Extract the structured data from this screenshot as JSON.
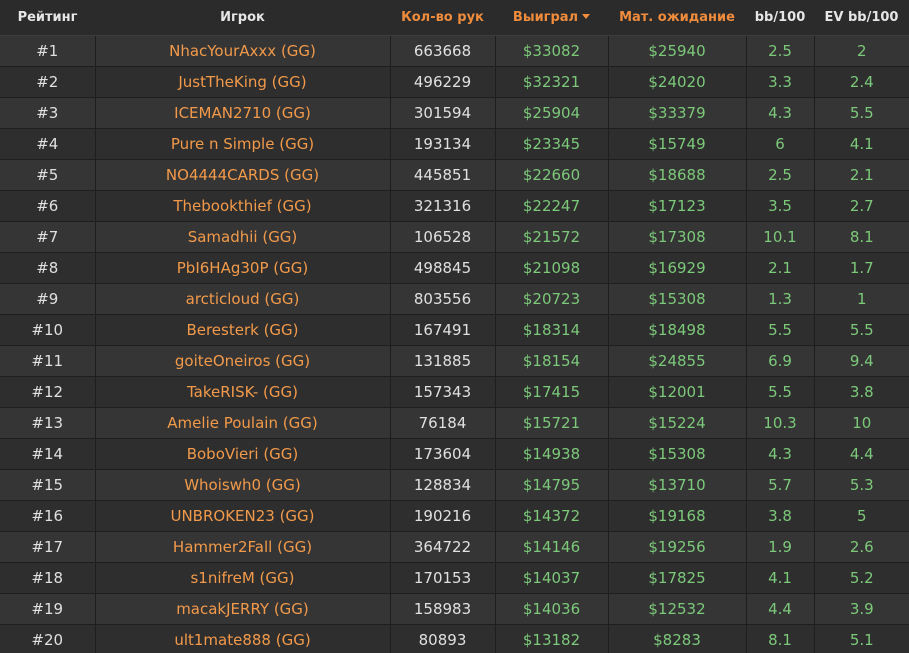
{
  "columns": {
    "rank": "Рейтинг",
    "player": "Игрок",
    "hands": "Кол-во рук",
    "won": "Выиграл",
    "ev": "Мат. ожидание",
    "bb100": "bb/100",
    "evbb100": "EV bb/100"
  },
  "sort": {
    "column": "won",
    "direction": "desc",
    "icon": "caret-down-icon"
  },
  "colors": {
    "background": "#2b2b2b",
    "row_odd": "#353535",
    "row_even": "#2e2e2e",
    "player_link": "#f29a4a",
    "header_accent": "#f08c3c",
    "money_green": "#7cc97a",
    "text_light": "#e0e0e0"
  },
  "rows": [
    {
      "rank": "#1",
      "player": "NhacYourAxxx (GG)",
      "hands": "663668",
      "won": "$33082",
      "ev": "$25940",
      "bb100": "2.5",
      "evbb100": "2"
    },
    {
      "rank": "#2",
      "player": "JustTheKing (GG)",
      "hands": "496229",
      "won": "$32321",
      "ev": "$24020",
      "bb100": "3.3",
      "evbb100": "2.4"
    },
    {
      "rank": "#3",
      "player": "ICEMAN2710 (GG)",
      "hands": "301594",
      "won": "$25904",
      "ev": "$33379",
      "bb100": "4.3",
      "evbb100": "5.5"
    },
    {
      "rank": "#4",
      "player": "Pure n Simple (GG)",
      "hands": "193134",
      "won": "$23345",
      "ev": "$15749",
      "bb100": "6",
      "evbb100": "4.1"
    },
    {
      "rank": "#5",
      "player": "NO4444CARDS (GG)",
      "hands": "445851",
      "won": "$22660",
      "ev": "$18688",
      "bb100": "2.5",
      "evbb100": "2.1"
    },
    {
      "rank": "#6",
      "player": "Thebookthief (GG)",
      "hands": "321316",
      "won": "$22247",
      "ev": "$17123",
      "bb100": "3.5",
      "evbb100": "2.7"
    },
    {
      "rank": "#7",
      "player": "Samadhii (GG)",
      "hands": "106528",
      "won": "$21572",
      "ev": "$17308",
      "bb100": "10.1",
      "evbb100": "8.1"
    },
    {
      "rank": "#8",
      "player": "PbI6HAg30P (GG)",
      "hands": "498845",
      "won": "$21098",
      "ev": "$16929",
      "bb100": "2.1",
      "evbb100": "1.7"
    },
    {
      "rank": "#9",
      "player": "arcticloud (GG)",
      "hands": "803556",
      "won": "$20723",
      "ev": "$15308",
      "bb100": "1.3",
      "evbb100": "1"
    },
    {
      "rank": "#10",
      "player": "Beresterk (GG)",
      "hands": "167491",
      "won": "$18314",
      "ev": "$18498",
      "bb100": "5.5",
      "evbb100": "5.5"
    },
    {
      "rank": "#11",
      "player": "goiteOneiros (GG)",
      "hands": "131885",
      "won": "$18154",
      "ev": "$24855",
      "bb100": "6.9",
      "evbb100": "9.4"
    },
    {
      "rank": "#12",
      "player": "TakeRISK- (GG)",
      "hands": "157343",
      "won": "$17415",
      "ev": "$12001",
      "bb100": "5.5",
      "evbb100": "3.8"
    },
    {
      "rank": "#13",
      "player": "Amelie Poulain (GG)",
      "hands": "76184",
      "won": "$15721",
      "ev": "$15224",
      "bb100": "10.3",
      "evbb100": "10"
    },
    {
      "rank": "#14",
      "player": "BoboVieri (GG)",
      "hands": "173604",
      "won": "$14938",
      "ev": "$15308",
      "bb100": "4.3",
      "evbb100": "4.4"
    },
    {
      "rank": "#15",
      "player": "Whoiswh0 (GG)",
      "hands": "128834",
      "won": "$14795",
      "ev": "$13710",
      "bb100": "5.7",
      "evbb100": "5.3"
    },
    {
      "rank": "#16",
      "player": "UNBROKEN23 (GG)",
      "hands": "190216",
      "won": "$14372",
      "ev": "$19168",
      "bb100": "3.8",
      "evbb100": "5"
    },
    {
      "rank": "#17",
      "player": "Hammer2Fall (GG)",
      "hands": "364722",
      "won": "$14146",
      "ev": "$19256",
      "bb100": "1.9",
      "evbb100": "2.6"
    },
    {
      "rank": "#18",
      "player": "s1nifreM (GG)",
      "hands": "170153",
      "won": "$14037",
      "ev": "$17825",
      "bb100": "4.1",
      "evbb100": "5.2"
    },
    {
      "rank": "#19",
      "player": "macakJERRY (GG)",
      "hands": "158983",
      "won": "$14036",
      "ev": "$12532",
      "bb100": "4.4",
      "evbb100": "3.9"
    },
    {
      "rank": "#20",
      "player": "ult1mate888 (GG)",
      "hands": "80893",
      "won": "$13182",
      "ev": "$8283",
      "bb100": "8.1",
      "evbb100": "5.1"
    }
  ]
}
